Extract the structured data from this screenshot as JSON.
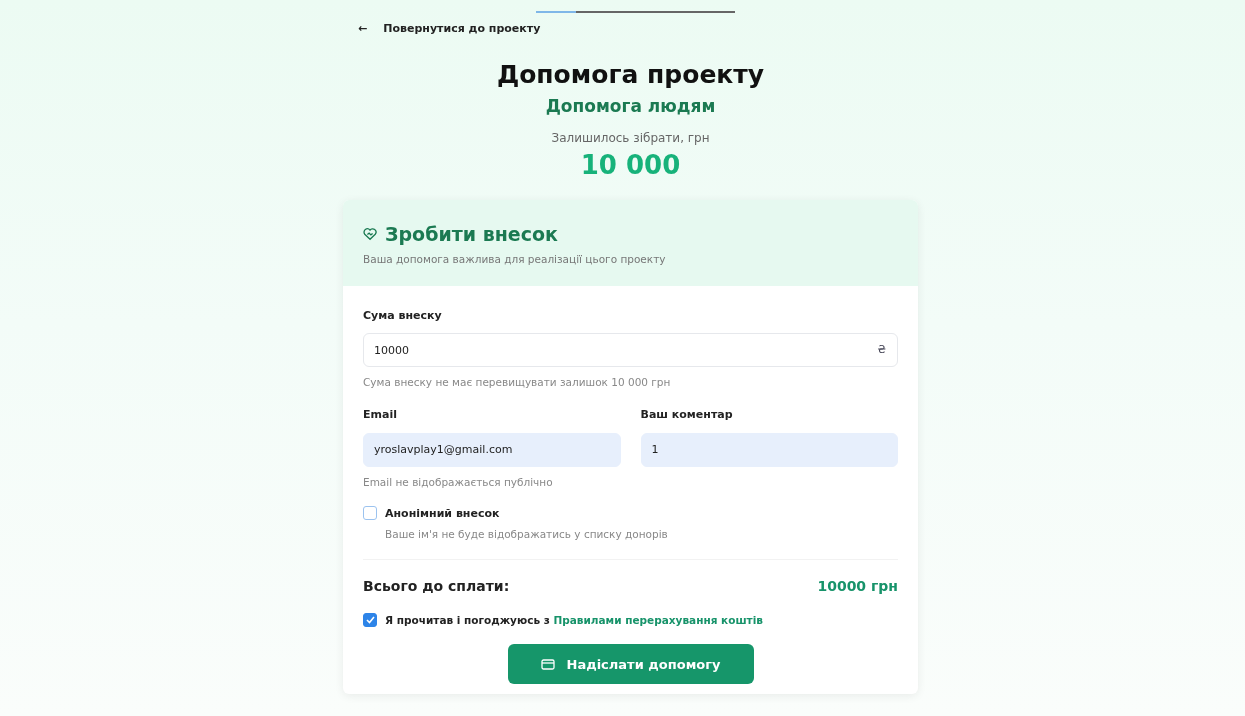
{
  "top_progress": {
    "level": 0.2
  },
  "back_link": {
    "icon": "←",
    "label": "Повернутися до проекту"
  },
  "header": {
    "title": "Допомога проекту",
    "subtitle": "Допомога людям",
    "remaining_label": "Залишилось зібрати, грн",
    "remaining_amount": "10 000"
  },
  "card": {
    "title": "Зробити внесок",
    "subtitle": "Ваша допомога важлива для реалізації цього проекту",
    "amount": {
      "label": "Сума внеску",
      "value": "10000",
      "suffix": "₴",
      "hint": "Сума внеску не має перевищувати залишок 10 000 грн"
    },
    "email": {
      "label": "Email",
      "value": "yroslavplay1@gmail.com",
      "hint": "Email не відображається публічно"
    },
    "comment": {
      "label": "Ваш коментар",
      "value": "1"
    },
    "anonymous": {
      "label": "Анонімний внесок",
      "hint": "Ваше ім'я не буде відображатись у списку донорів",
      "checked": false
    },
    "total": {
      "label": "Всього до сплати:",
      "value": "10000 грн"
    },
    "agree": {
      "text": "Я прочитав і погоджуюсь з",
      "link": "Правилами перерахування коштів",
      "checked": true
    },
    "submit": {
      "label": "Надіслати допомогу"
    }
  }
}
